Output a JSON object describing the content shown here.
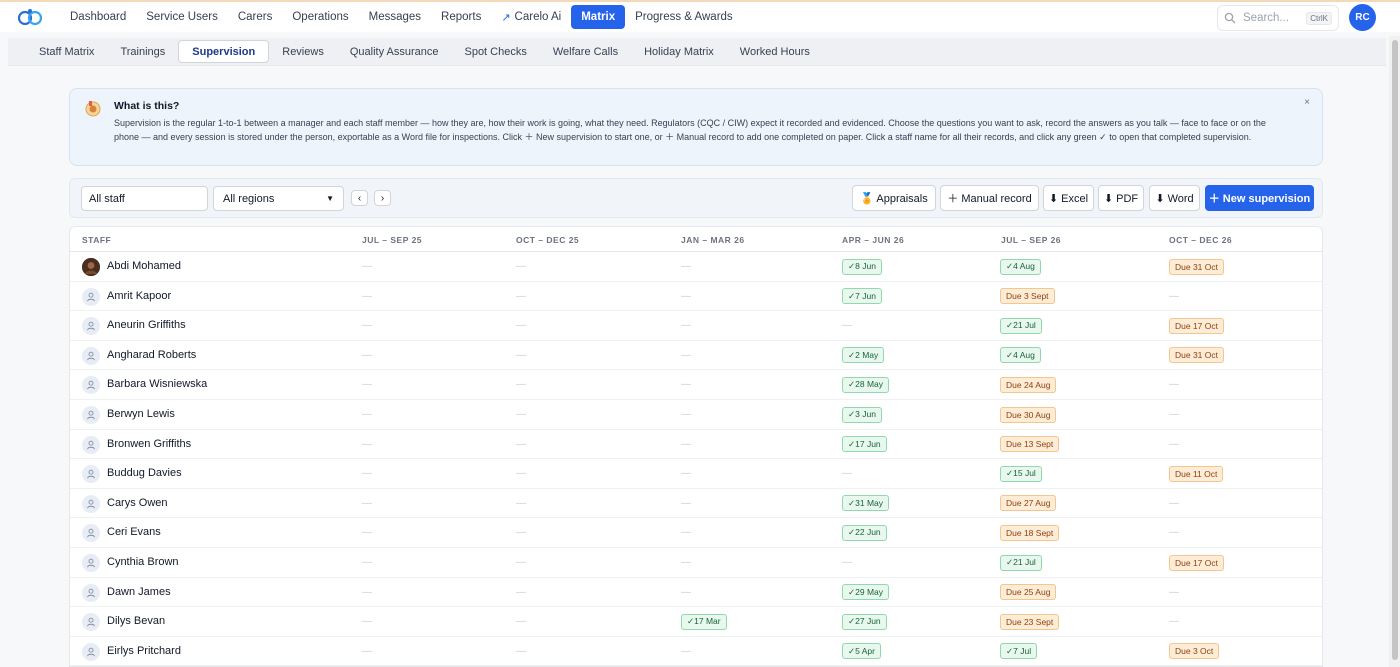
{
  "topnav": {
    "items": [
      {
        "label": "Dashboard",
        "name": "nav-dashboard"
      },
      {
        "label": "Service Users",
        "name": "nav-service-users"
      },
      {
        "label": "Carers",
        "name": "nav-carers"
      },
      {
        "label": "Operations",
        "name": "nav-operations"
      },
      {
        "label": "Messages",
        "name": "nav-messages"
      },
      {
        "label": "Reports",
        "name": "nav-reports"
      },
      {
        "label": "Carelo Ai",
        "name": "nav-carelo-ai",
        "icon": "wand-icon"
      },
      {
        "label": "Matrix",
        "name": "nav-matrix",
        "active": true
      },
      {
        "label": "Progress & Awards",
        "name": "nav-progress-awards"
      }
    ],
    "search_placeholder": "Search...",
    "search_shortcut": "CtrlK",
    "user_initials": "RC",
    "accent": "#2563eb"
  },
  "subnav": {
    "items": [
      {
        "label": "Staff Matrix"
      },
      {
        "label": "Trainings"
      },
      {
        "label": "Supervision",
        "active": true
      },
      {
        "label": "Reviews"
      },
      {
        "label": "Quality Assurance"
      },
      {
        "label": "Spot Checks"
      },
      {
        "label": "Welfare Calls"
      },
      {
        "label": "Holiday Matrix"
      },
      {
        "label": "Worked Hours"
      }
    ]
  },
  "info": {
    "title": "What is this?",
    "body": "Supervision is the regular 1-to-1 between a manager and each staff member — how they are, how their work is going, what they need. Regulators (CQC / CIW) expect it recorded and evidenced. Choose the questions you want to ask, record the answers as you talk — face to face or on the phone — and every session is stored under the person, exportable as a Word file for inspections. Click ＋ New supervision to start one, or ＋ Manual record to add one completed on paper. Click a staff name for all their records, and click any green ✓ to open that completed supervision.",
    "close": "×"
  },
  "toolbar": {
    "staff_filter_value": "All staff",
    "region_value": "All regions",
    "prev": "‹",
    "next": "›",
    "appraisals": "🏅 Appraisals",
    "manual_record": "＋ Manual record",
    "excel": "⬇ Excel",
    "pdf": "⬇ PDF",
    "word": "⬇ Word",
    "new_supervision": "＋ New supervision"
  },
  "table": {
    "headers": [
      "STAFF",
      "JUL – SEP 25",
      "OCT – DEC 25",
      "JAN – MAR 26",
      "APR – JUN 26",
      "JUL – SEP 26",
      "OCT – DEC 26"
    ],
    "rows": [
      {
        "name": "Abdi Mohamed",
        "photo": true,
        "cells": [
          "—",
          "—",
          "—",
          "✓8 Jun",
          "✓4 Aug",
          "Due 31 Oct"
        ]
      },
      {
        "name": "Amrit Kapoor",
        "cells": [
          "—",
          "—",
          "—",
          "✓7 Jun",
          "Due 3 Sept",
          "—"
        ]
      },
      {
        "name": "Aneurin Griffiths",
        "cells": [
          "—",
          "—",
          "—",
          "—",
          "✓21 Jul",
          "Due 17 Oct"
        ]
      },
      {
        "name": "Angharad Roberts",
        "cells": [
          "—",
          "—",
          "—",
          "✓2 May",
          "✓4 Aug",
          "Due 31 Oct"
        ]
      },
      {
        "name": "Barbara Wisniewska",
        "cells": [
          "—",
          "—",
          "—",
          "✓28 May",
          "Due 24 Aug",
          "—"
        ]
      },
      {
        "name": "Berwyn Lewis",
        "cells": [
          "—",
          "—",
          "—",
          "✓3 Jun",
          "Due 30 Aug",
          "—"
        ]
      },
      {
        "name": "Bronwen Griffiths",
        "cells": [
          "—",
          "—",
          "—",
          "✓17 Jun",
          "Due 13 Sept",
          "—"
        ]
      },
      {
        "name": "Buddug Davies",
        "cells": [
          "—",
          "—",
          "—",
          "—",
          "✓15 Jul",
          "Due 11 Oct"
        ]
      },
      {
        "name": "Carys Owen",
        "cells": [
          "—",
          "—",
          "—",
          "✓31 May",
          "Due 27 Aug",
          "—"
        ]
      },
      {
        "name": "Ceri Evans",
        "cells": [
          "—",
          "—",
          "—",
          "✓22 Jun",
          "Due 18 Sept",
          "—"
        ]
      },
      {
        "name": "Cynthia Brown",
        "cells": [
          "—",
          "—",
          "—",
          "—",
          "✓21 Jul",
          "Due 17 Oct"
        ]
      },
      {
        "name": "Dawn James",
        "cells": [
          "—",
          "—",
          "—",
          "✓29 May",
          "Due 25 Aug",
          "—"
        ]
      },
      {
        "name": "Dilys Bevan",
        "cells": [
          "—",
          "—",
          "✓17 Mar",
          "✓27 Jun",
          "Due 23 Sept",
          "—"
        ]
      },
      {
        "name": "Eirlys Pritchard",
        "cells": [
          "—",
          "—",
          "—",
          "✓5 Apr",
          "✓7 Jul",
          "Due 3 Oct"
        ]
      }
    ]
  }
}
